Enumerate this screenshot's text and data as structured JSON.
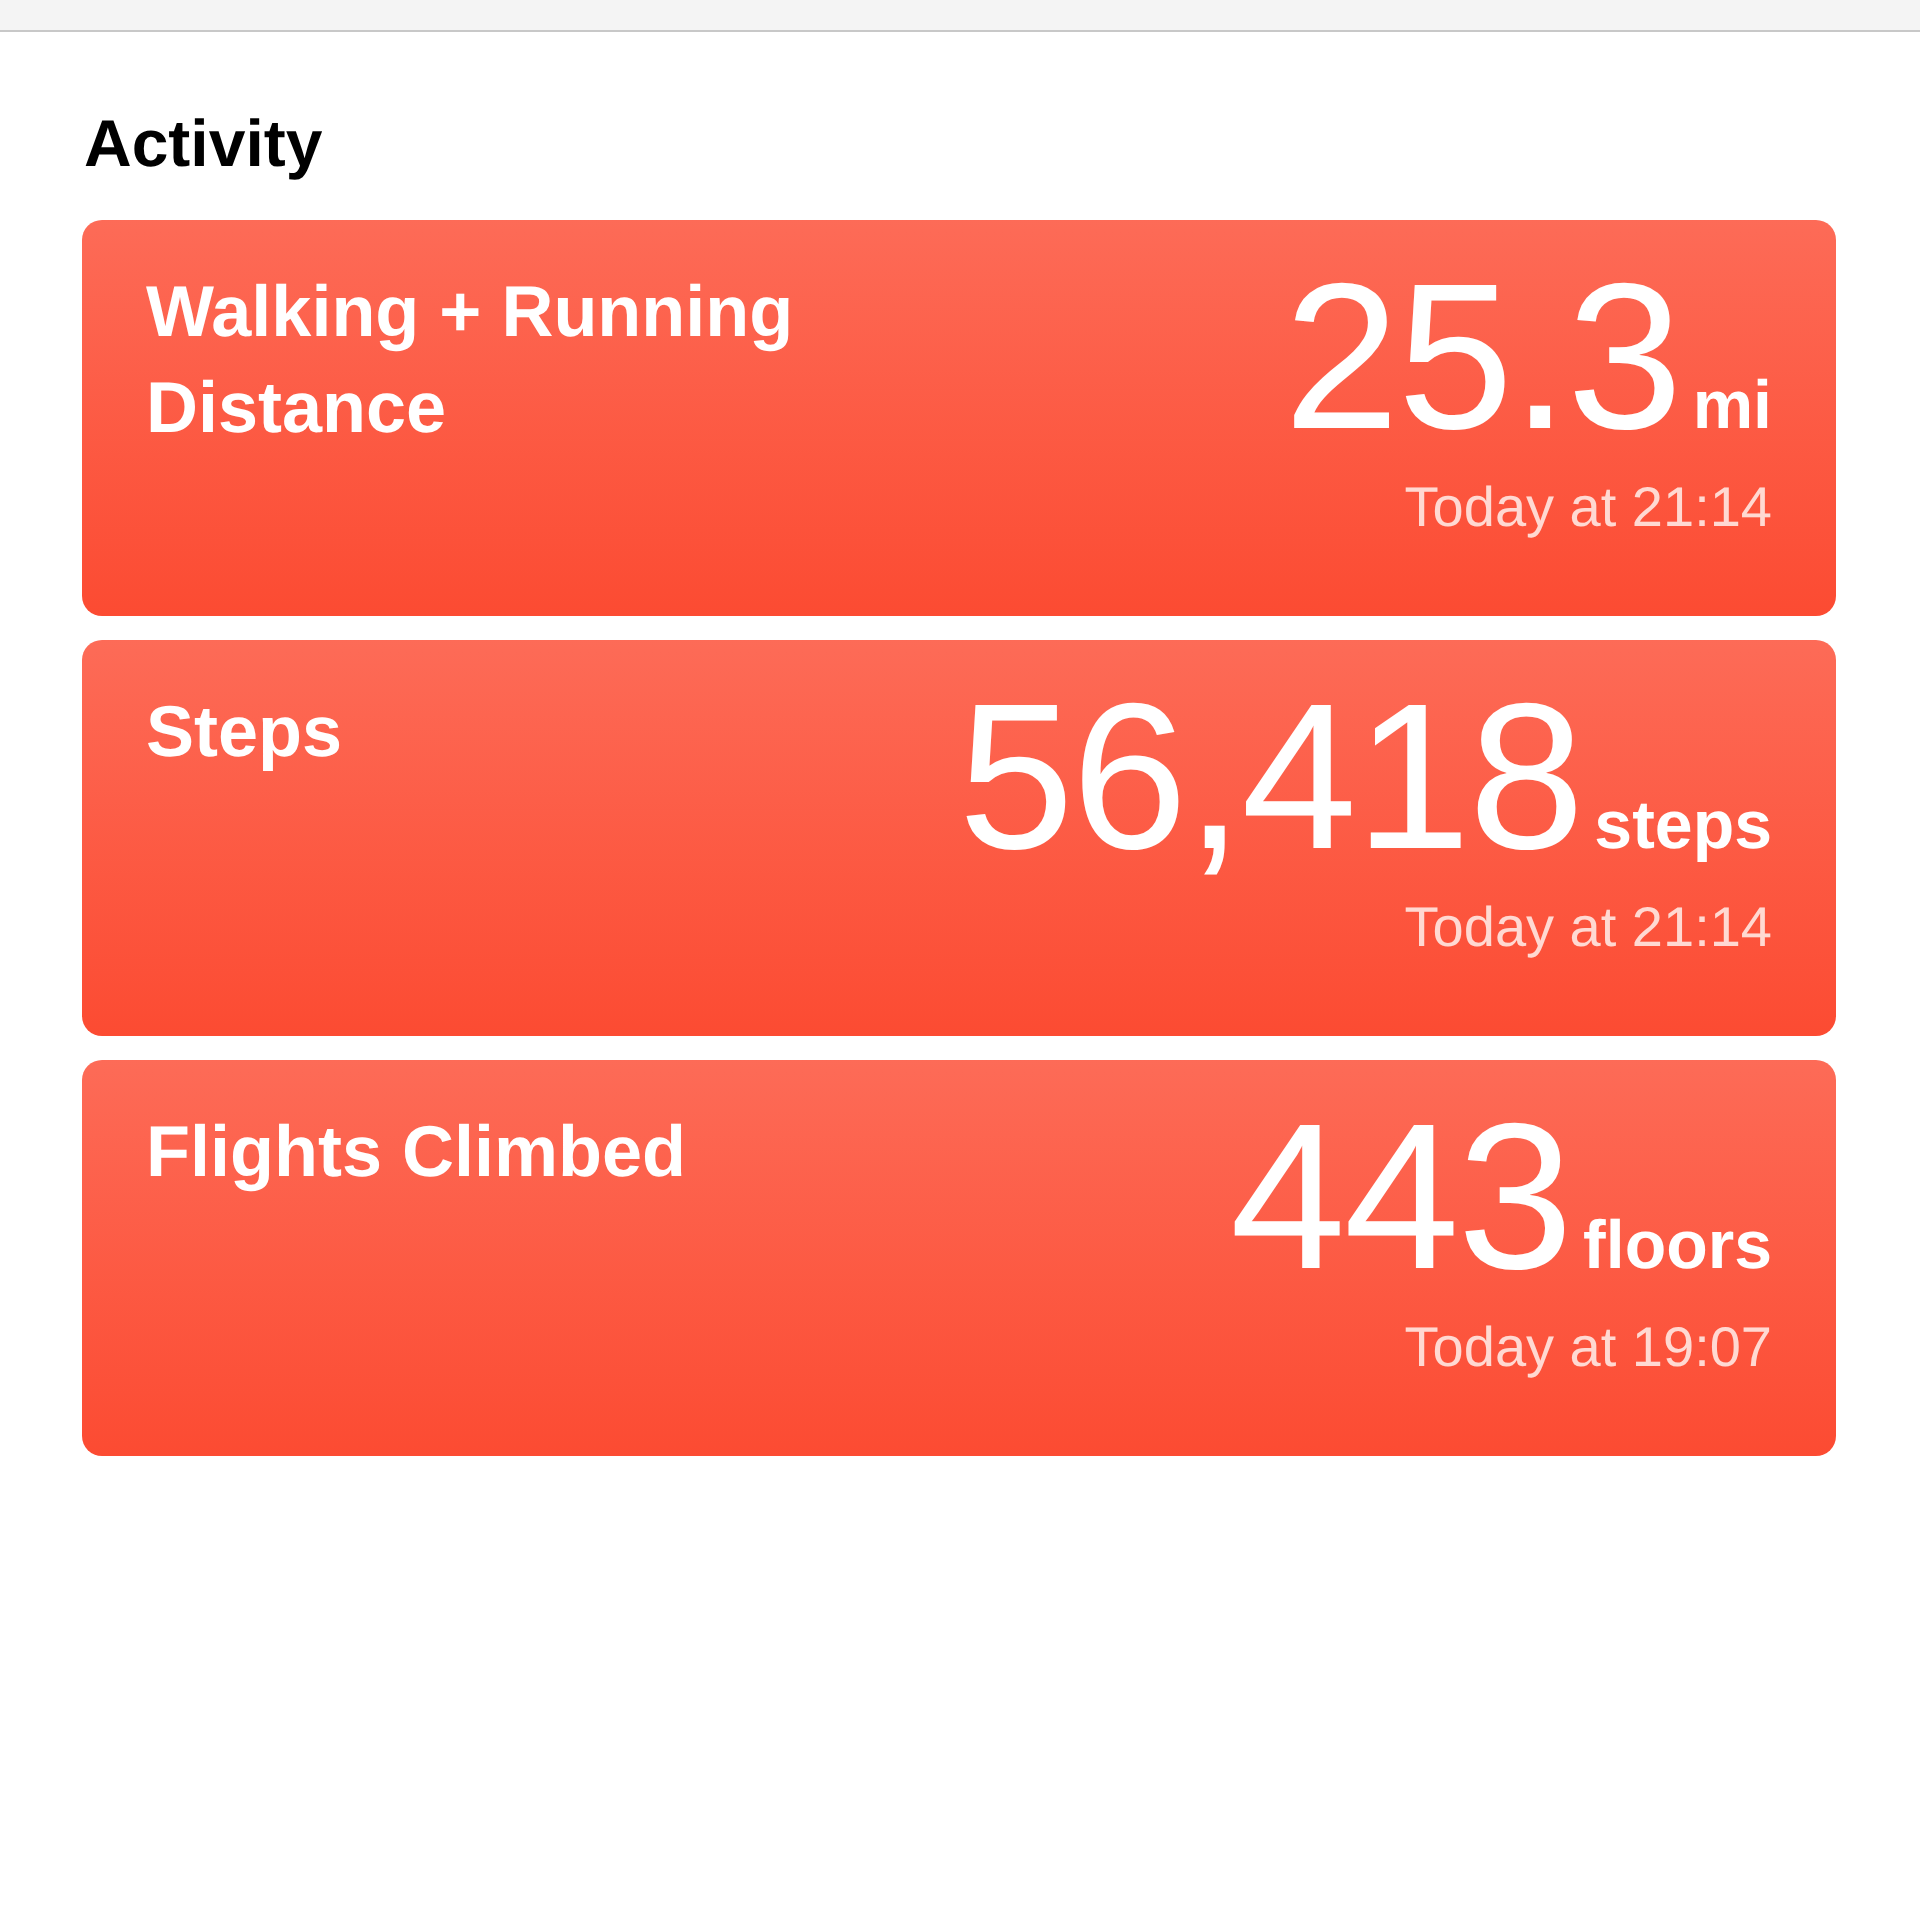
{
  "section_title": "Activity",
  "cards": [
    {
      "title": "Walking + Running Distance",
      "value": "25.3",
      "unit": "mi",
      "time": "Today at 21:14"
    },
    {
      "title": "Steps",
      "value": "56,418",
      "unit": "steps",
      "time": "Today at 21:14"
    },
    {
      "title": "Flights Climbed",
      "value": "443",
      "unit": "floors",
      "time": "Today at 19:07"
    }
  ]
}
